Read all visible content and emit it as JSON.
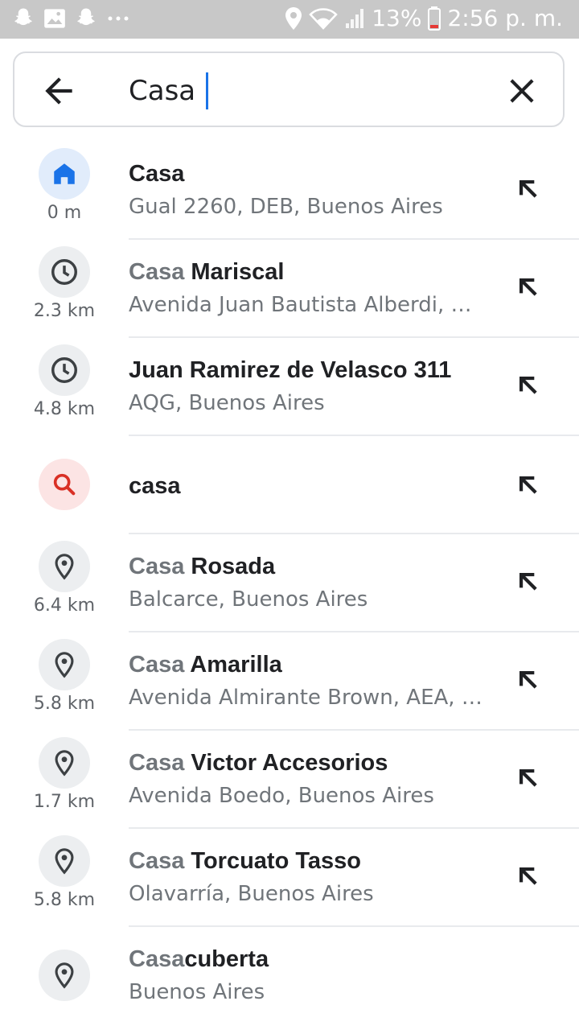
{
  "status_bar": {
    "left_icons": [
      "snapchat-icon",
      "image-icon",
      "snapchat-icon",
      "more-icon"
    ],
    "right_icons": [
      "location-icon",
      "wifi-icon",
      "signal-icon"
    ],
    "battery": "13%",
    "time": "2:56 p. m."
  },
  "search": {
    "query": "Casa",
    "back_icon": "back-arrow-icon",
    "clear_icon": "close-icon"
  },
  "results": [
    {
      "icon": "home-icon",
      "distance": "0 m",
      "highlight": "",
      "rest": "Casa",
      "subtitle": "Gual 2260, DEB, Buenos Aires"
    },
    {
      "icon": "history-icon",
      "distance": "2.3 km",
      "highlight": "Casa",
      "rest": " Mariscal",
      "subtitle": "Avenida Juan Bautista Alberdi, BY…"
    },
    {
      "icon": "history-icon",
      "distance": "4.8 km",
      "highlight": "",
      "rest": "Juan Ramirez de Velasco 311",
      "subtitle": "AQG, Buenos Aires"
    },
    {
      "icon": "search-icon",
      "distance": "",
      "highlight": "",
      "rest": "casa",
      "subtitle": ""
    },
    {
      "icon": "place-icon",
      "distance": "6.4 km",
      "highlight": "Casa",
      "rest": " Rosada",
      "subtitle": "Balcarce, Buenos Aires"
    },
    {
      "icon": "place-icon",
      "distance": "5.8 km",
      "highlight": "Casa",
      "rest": " Amarilla",
      "subtitle": "Avenida Almirante Brown, AEA, Bu…"
    },
    {
      "icon": "place-icon",
      "distance": "1.7 km",
      "highlight": "Casa",
      "rest": " Victor Accesorios",
      "subtitle": "Avenida Boedo, Buenos Aires"
    },
    {
      "icon": "place-icon",
      "distance": "5.8 km",
      "highlight": "Casa",
      "rest": " Torcuato Tasso",
      "subtitle": "Olavarría, Buenos Aires"
    },
    {
      "icon": "place-icon",
      "distance": "",
      "highlight": "Casa",
      "rest": "cuberta",
      "subtitle": "Buenos Aires"
    }
  ],
  "colors": {
    "accent": "#1a73e8",
    "search_red": "#d93025",
    "icon_gray": "#3c4043"
  }
}
